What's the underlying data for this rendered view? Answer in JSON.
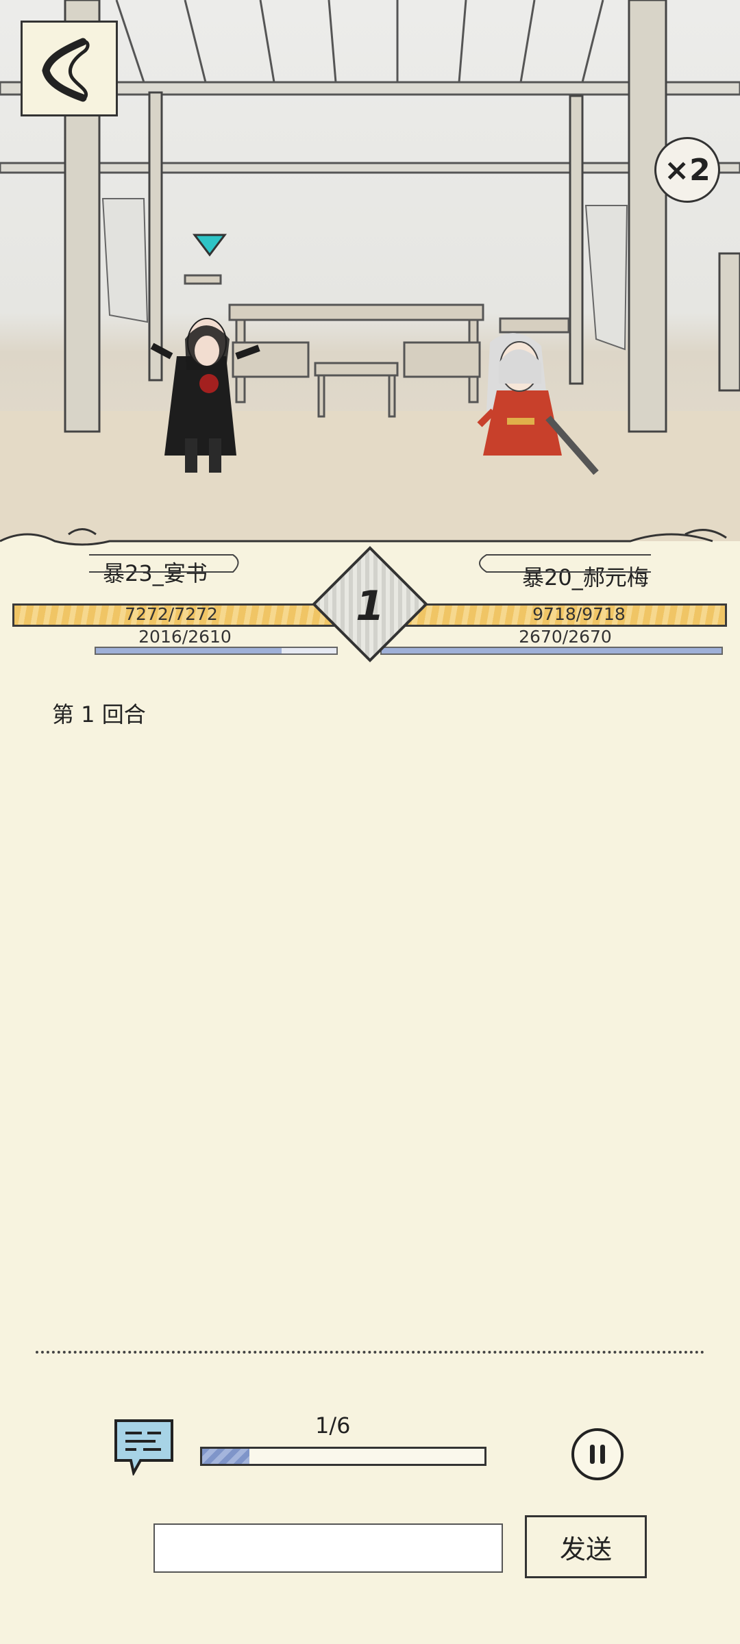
{
  "battle": {
    "player_left": {
      "name": "暴23_宴书",
      "hp_text": "7272/7272",
      "mp_text": "2016/2610",
      "hp_fraction": 1.0,
      "mp_fraction": 0.772
    },
    "player_right": {
      "name": "暴20_郝元梅",
      "hp_text": "9718/9718",
      "mp_text": "2670/2670",
      "hp_fraction": 1.0,
      "mp_fraction": 1.0
    },
    "round_number": "1",
    "speed_label": "×2"
  },
  "log": {
    "lines": [
      "第 1 回合"
    ]
  },
  "playback": {
    "progress_label": "1/6",
    "progress_fraction": 0.1667
  },
  "chat": {
    "input_value": "",
    "send_label": "发送"
  },
  "icons": {
    "back": "back-arrow-icon",
    "chat": "chat-bubble-icon",
    "pause": "pause-icon",
    "speed": "speed-x2-icon",
    "turn": "turn-indicator-icon"
  }
}
